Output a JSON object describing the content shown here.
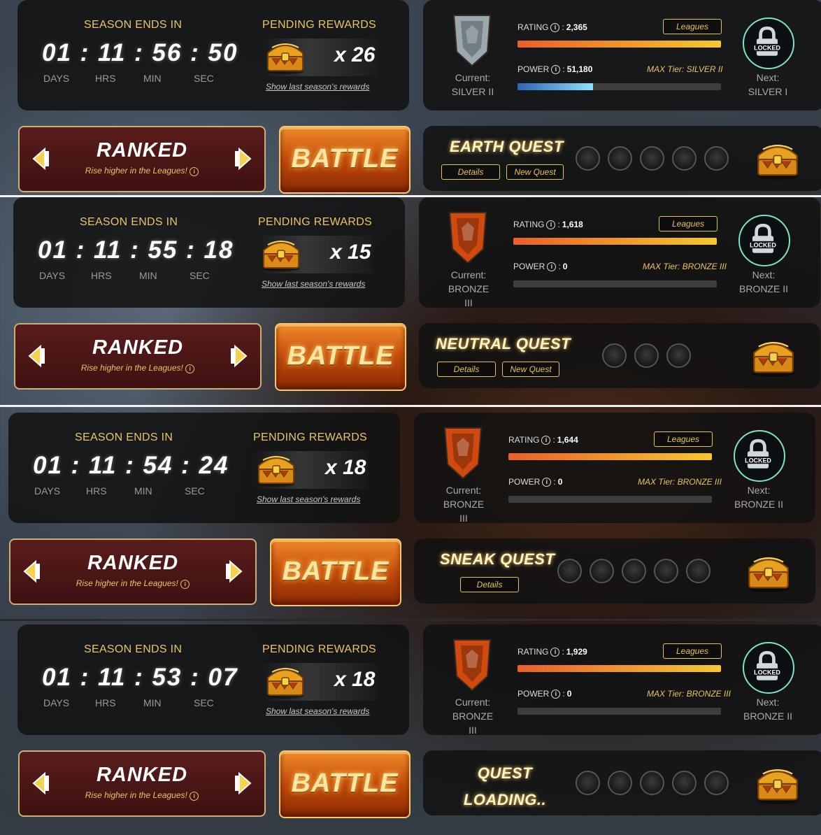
{
  "frames": [
    {
      "season": {
        "title": "SEASON ENDS IN",
        "timer": "01 : 11 : 56 : 50",
        "labels": {
          "days": "DAYS",
          "hrs": "HRS",
          "min": "MIN",
          "sec": "SEC"
        }
      },
      "rewards": {
        "title": "PENDING REWARDS",
        "count": "x 26",
        "link": "Show last season's rewards"
      },
      "league": {
        "current_label": "Current:",
        "current": "SILVER II",
        "rating_label": "RATING",
        "rating": "2,365",
        "rating_fill": 1.0,
        "power_label": "POWER",
        "power": "51,180",
        "power_fill": 0.37,
        "leagues_btn": "Leagues",
        "max_tier": "MAX Tier: SILVER II",
        "locked": "LOCKED",
        "next_label": "Next:",
        "next": "SILVER I",
        "badge_color": "#9aa8b0"
      },
      "ranked": {
        "title": "RANKED",
        "subtitle": "Rise higher in the Leagues!"
      },
      "battle": "BATTLE",
      "quest": {
        "title": "EARTH QUEST",
        "details": "Details",
        "new_quest": "New Quest",
        "dots": 5,
        "loading": false
      }
    },
    {
      "season": {
        "title": "SEASON ENDS IN",
        "timer": "01 : 11 : 55 : 18",
        "labels": {
          "days": "DAYS",
          "hrs": "HRS",
          "min": "MIN",
          "sec": "SEC"
        }
      },
      "rewards": {
        "title": "PENDING REWARDS",
        "count": "x 15",
        "link": "Show last season's rewards"
      },
      "league": {
        "current_label": "Current:",
        "current": "BRONZE III",
        "rating_label": "RATING",
        "rating": "1,618",
        "rating_fill": 1.0,
        "power_label": "POWER",
        "power": "0",
        "power_fill": 0.0,
        "leagues_btn": "Leagues",
        "max_tier": "MAX Tier: BRONZE III",
        "locked": "LOCKED",
        "next_label": "Next:",
        "next": "BRONZE II",
        "badge_color": "#d04a10"
      },
      "ranked": {
        "title": "RANKED",
        "subtitle": "Rise higher in the Leagues!"
      },
      "battle": "BATTLE",
      "quest": {
        "title": "NEUTRAL QUEST",
        "details": "Details",
        "new_quest": "New Quest",
        "dots": 3,
        "loading": false
      }
    },
    {
      "season": {
        "title": "SEASON ENDS IN",
        "timer": "01 : 11 : 54 : 24",
        "labels": {
          "days": "DAYS",
          "hrs": "HRS",
          "min": "MIN",
          "sec": "SEC"
        }
      },
      "rewards": {
        "title": "PENDING REWARDS",
        "count": "x 18",
        "link": "Show last season's rewards"
      },
      "league": {
        "current_label": "Current:",
        "current": "BRONZE III",
        "rating_label": "RATING",
        "rating": "1,644",
        "rating_fill": 1.0,
        "power_label": "POWER",
        "power": "0",
        "power_fill": 0.0,
        "leagues_btn": "Leagues",
        "max_tier": "MAX Tier: BRONZE III",
        "locked": "LOCKED",
        "next_label": "Next:",
        "next": "BRONZE II",
        "badge_color": "#d04a10"
      },
      "ranked": {
        "title": "RANKED",
        "subtitle": "Rise higher in the Leagues!"
      },
      "battle": "BATTLE",
      "quest": {
        "title": "SNEAK QUEST",
        "details": "Details",
        "new_quest": "",
        "dots": 5,
        "loading": false
      }
    },
    {
      "season": {
        "title": "SEASON ENDS IN",
        "timer": "01 : 11 : 53 : 07",
        "labels": {
          "days": "DAYS",
          "hrs": "HRS",
          "min": "MIN",
          "sec": "SEC"
        }
      },
      "rewards": {
        "title": "PENDING REWARDS",
        "count": "x 18",
        "link": "Show last season's rewards"
      },
      "league": {
        "current_label": "Current:",
        "current": "BRONZE III",
        "rating_label": "RATING",
        "rating": "1,929",
        "rating_fill": 1.0,
        "power_label": "POWER",
        "power": "0",
        "power_fill": 0.0,
        "leagues_btn": "Leagues",
        "max_tier": "MAX Tier: BRONZE III",
        "locked": "LOCKED",
        "next_label": "Next:",
        "next": "BRONZE II",
        "badge_color": "#d04a10"
      },
      "ranked": {
        "title": "RANKED",
        "subtitle": "Rise higher in the Leagues!"
      },
      "battle": "BATTLE",
      "quest": {
        "title": "",
        "details": "",
        "new_quest": "",
        "dots": 5,
        "loading": true,
        "loading_text": [
          "QUEST",
          "LOADING.."
        ]
      }
    }
  ],
  "icons": {
    "chest": "treasure-chest-icon",
    "lock": "lock-icon",
    "info": "info-icon",
    "arrow_left": "chevron-left-icon",
    "arrow_right": "chevron-right-icon"
  }
}
